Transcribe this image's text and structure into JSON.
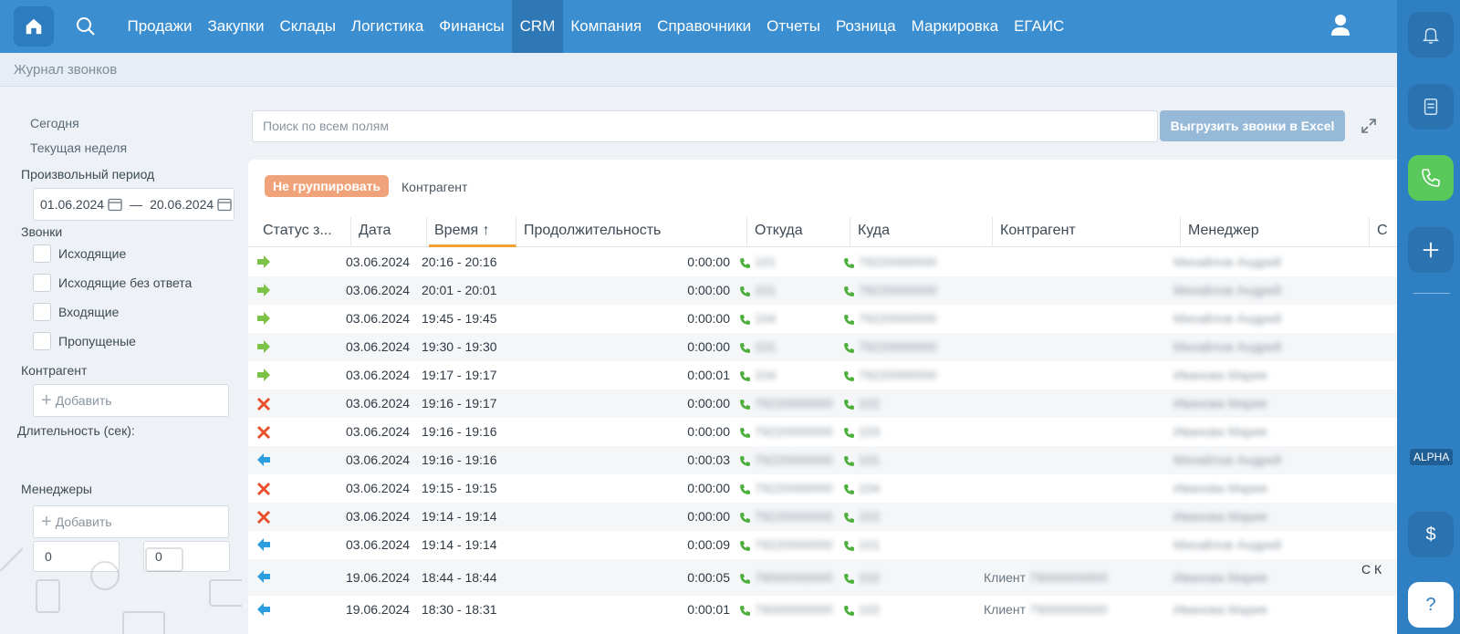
{
  "nav": {
    "items": [
      "Продажи",
      "Закупки",
      "Склады",
      "Логистика",
      "Финансы",
      "CRM",
      "Компания",
      "Справочники",
      "Отчеты",
      "Розница",
      "Маркировка",
      "ЕГАИС"
    ],
    "active_index": 5
  },
  "breadcrumb": "Журнал звонков",
  "rail": {
    "alpha_badge": "ALPHA",
    "help_label": "?",
    "currency_label": "$"
  },
  "sidebar": {
    "today": "Сегодня",
    "current_week": "Текущая неделя",
    "custom_period": "Произвольный период",
    "date_from": "01.06.2024",
    "date_sep": "—",
    "date_to": "20.06.2024",
    "calls_header": "Звонки",
    "call_types": [
      "Исходящие",
      "Исходящие без ответа",
      "Входящие",
      "Пропущеные"
    ],
    "counterparty_header": "Контрагент",
    "add_label": "Добавить",
    "duration_header": "Длительность (сек):",
    "duration_from": "0",
    "duration_to": "0",
    "managers_header": "Менеджеры"
  },
  "search": {
    "placeholder": "Поиск по всем полям"
  },
  "export_button": "Выгрузить звонки в Excel",
  "grouping": {
    "no_group": "Не группировать",
    "counterparty": "Контрагент"
  },
  "columns": [
    "Статус з...",
    "Дата",
    "Время ↑",
    "Продолжительность",
    "Откуда",
    "Куда",
    "Контрагент",
    "Менеджер",
    "С"
  ],
  "colors": {
    "outgoing": "#7cc246",
    "missed": "#e8502c",
    "incoming": "#2c9ee0",
    "phone": "#4caf3c"
  },
  "rows": [
    {
      "status": "outgoing",
      "date": "03.06.2024",
      "time": "20:16 - 20:16",
      "duration": "0:00:00",
      "from": "101",
      "to": "79220000000",
      "counterparty": "",
      "counterparty_name": "",
      "manager": "Михайлов Андрей",
      "extra": ""
    },
    {
      "status": "outgoing",
      "date": "03.06.2024",
      "time": "20:01 - 20:01",
      "duration": "0:00:00",
      "from": "101",
      "to": "79220000000",
      "counterparty": "",
      "counterparty_name": "",
      "manager": "Михайлов Андрей",
      "extra": ""
    },
    {
      "status": "outgoing",
      "date": "03.06.2024",
      "time": "19:45 - 19:45",
      "duration": "0:00:00",
      "from": "104",
      "to": "79220000000",
      "counterparty": "",
      "counterparty_name": "",
      "manager": "Михайлов Андрей",
      "extra": ""
    },
    {
      "status": "outgoing",
      "date": "03.06.2024",
      "time": "19:30 - 19:30",
      "duration": "0:00:00",
      "from": "101",
      "to": "79220000000",
      "counterparty": "",
      "counterparty_name": "",
      "manager": "Михайлов Андрей",
      "extra": ""
    },
    {
      "status": "outgoing",
      "date": "03.06.2024",
      "time": "19:17 - 19:17",
      "duration": "0:00:01",
      "from": "104",
      "to": "79220000000",
      "counterparty": "",
      "counterparty_name": "",
      "manager": "Иванова Мария",
      "extra": ""
    },
    {
      "status": "missed",
      "date": "03.06.2024",
      "time": "19:16 - 19:17",
      "duration": "0:00:00",
      "from": "79220000000",
      "to": "102",
      "counterparty": "",
      "counterparty_name": "",
      "manager": "Иванова Мария",
      "extra": ""
    },
    {
      "status": "missed",
      "date": "03.06.2024",
      "time": "19:16 - 19:16",
      "duration": "0:00:00",
      "from": "79220000000",
      "to": "103",
      "counterparty": "",
      "counterparty_name": "",
      "manager": "Иванова Мария",
      "extra": ""
    },
    {
      "status": "incoming",
      "date": "03.06.2024",
      "time": "19:16 - 19:16",
      "duration": "0:00:03",
      "from": "79220000000",
      "to": "101",
      "counterparty": "",
      "counterparty_name": "",
      "manager": "Михайлов Андрей",
      "extra": ""
    },
    {
      "status": "missed",
      "date": "03.06.2024",
      "time": "19:15 - 19:15",
      "duration": "0:00:00",
      "from": "79220000000",
      "to": "104",
      "counterparty": "",
      "counterparty_name": "",
      "manager": "Иванова Мария",
      "extra": ""
    },
    {
      "status": "missed",
      "date": "03.06.2024",
      "time": "19:14 - 19:14",
      "duration": "0:00:00",
      "from": "79220000000",
      "to": "102",
      "counterparty": "",
      "counterparty_name": "",
      "manager": "Иванова Мария",
      "extra": ""
    },
    {
      "status": "incoming",
      "date": "03.06.2024",
      "time": "19:14 - 19:14",
      "duration": "0:00:09",
      "from": "79220000000",
      "to": "101",
      "counterparty": "",
      "counterparty_name": "",
      "manager": "Михайлов Андрей",
      "extra": ""
    },
    {
      "status": "incoming",
      "date": "19.06.2024",
      "time": "18:44 - 18:44",
      "duration": "0:00:05",
      "from": "79000000000",
      "to": "102",
      "counterparty": "Клиент",
      "counterparty_name": "79000000000",
      "manager": "Иванова Мария",
      "extra": "С К"
    },
    {
      "status": "incoming",
      "date": "19.06.2024",
      "time": "18:30 - 18:31",
      "duration": "0:00:01",
      "from": "79000000000",
      "to": "102",
      "counterparty": "Клиент",
      "counterparty_name": "79000000000",
      "manager": "Иванова Мария",
      "extra": ""
    }
  ]
}
